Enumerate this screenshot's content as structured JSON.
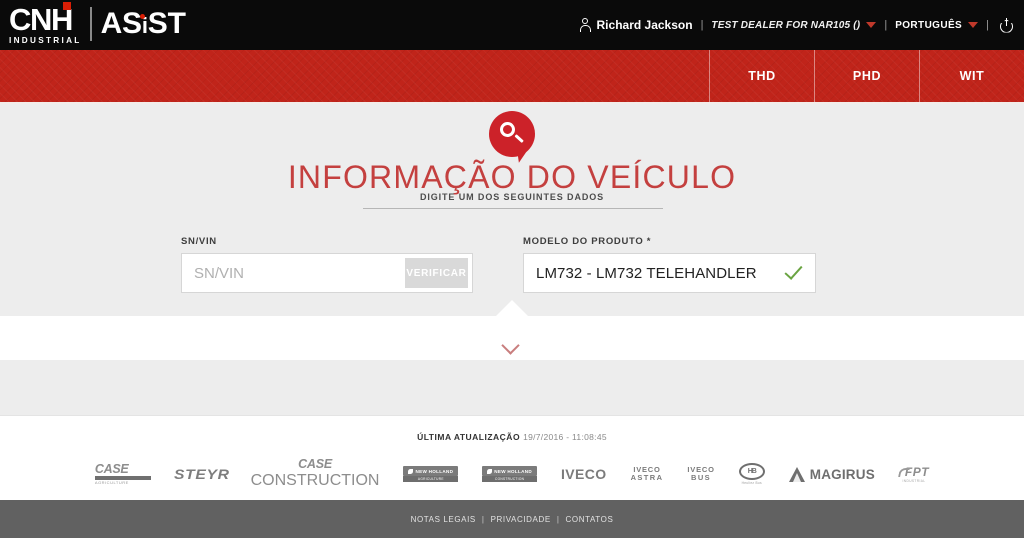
{
  "header": {
    "logo": {
      "brand": "CNH",
      "brand_sub": "INDUSTRIAL",
      "product_a": "AS",
      "product_i": "i",
      "product_b": "ST"
    },
    "user_name": "Richard Jackson",
    "dealer": "TEST DEALER FOR NAR105 ()",
    "language": "PORTUGUÊS",
    "sep": "|",
    "icons": {
      "user": "user-icon",
      "power": "power-icon",
      "caret": "chevron-down-icon"
    }
  },
  "nav": {
    "tabs": [
      {
        "label": "THD"
      },
      {
        "label": "PHD"
      },
      {
        "label": "WIT"
      }
    ]
  },
  "hero": {
    "title": "INFORMAÇÃO DO VEÍCULO",
    "subtitle": "DIGITE UM DOS SEGUINTES DADOS",
    "icon": "search-bubble-icon"
  },
  "form": {
    "snvin": {
      "label": "SN/VIN",
      "placeholder": "SN/VIN",
      "value": "",
      "button_label": "VERIFICAR"
    },
    "model": {
      "label": "MODELO DO PRODUTO *",
      "value": "LM732 - LM732 TELEHANDLER",
      "status_icon": "check-icon"
    }
  },
  "expander": {
    "icon": "chevron-down-icon"
  },
  "update": {
    "label": "ÚLTIMA ATUALIZAÇÃO",
    "timestamp": "19/7/2016 - 11:08:45"
  },
  "brands": [
    {
      "name": "CASE IH",
      "word": "CASE",
      "tiny": "AGRICULTURE"
    },
    {
      "name": "STEYR",
      "word": "STEYR",
      "tiny": ""
    },
    {
      "name": "CASE",
      "word": "CASE",
      "tiny": "CONSTRUCTION"
    },
    {
      "name": "NEW HOLLAND AGRICULTURE",
      "word": "NEW HOLLAND",
      "tiny": "AGRICULTURE"
    },
    {
      "name": "NEW HOLLAND CONSTRUCTION",
      "word": "NEW HOLLAND",
      "tiny": "CONSTRUCTION"
    },
    {
      "name": "IVECO",
      "word": "IVECO",
      "tiny": ""
    },
    {
      "name": "IVECO ASTRA",
      "word": "IVECO",
      "tiny": "ASTRA"
    },
    {
      "name": "IVECO BUS",
      "word": "IVECO",
      "tiny": "BUS"
    },
    {
      "name": "HEULIEZ BUS",
      "word": "HB",
      "tiny": "Heuliez Bus"
    },
    {
      "name": "MAGIRUS",
      "word": "MAGIRUS",
      "tiny": ""
    },
    {
      "name": "FPT INDUSTRIAL",
      "word": "FPT",
      "tiny": "INDUSTRIAL"
    }
  ],
  "footer": {
    "links": [
      {
        "label": "NOTAS LEGAIS"
      },
      {
        "label": "PRIVACIDADE"
      },
      {
        "label": "CONTATOS"
      }
    ],
    "separator": "|"
  },
  "colors": {
    "brand_red": "#c0241a",
    "accent_red": "#cc2229",
    "title_red": "#c4403f",
    "header_black": "#0a0a0a",
    "panel_gray": "#ededed",
    "footer_gray": "#616161",
    "check_green": "#6aa442"
  }
}
